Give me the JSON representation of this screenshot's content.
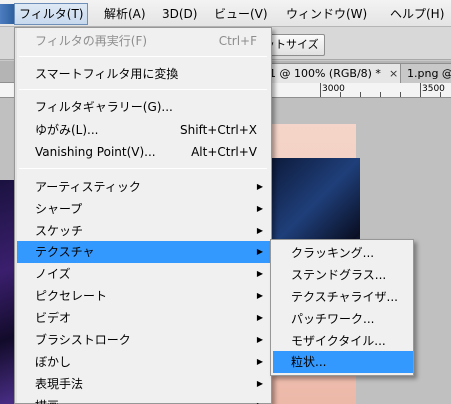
{
  "menubar": {
    "items": [
      {
        "label": "フィルタ(T)",
        "active": true
      },
      {
        "label": "解析(A)"
      },
      {
        "label": "3D(D)"
      },
      {
        "label": "ビュー(V)"
      },
      {
        "label": "ウィンドウ(W)"
      },
      {
        "label": "ヘルプ(H)"
      }
    ]
  },
  "options": {
    "fit_button_label": "ットサイズ"
  },
  "tabs": [
    {
      "label": "1 @ 100% (RGB/8) *",
      "close": "×"
    },
    {
      "label": "1.png @",
      "close": ""
    }
  ],
  "ruler": {
    "labels": [
      "3000",
      "3500"
    ]
  },
  "filter_menu": {
    "items": [
      {
        "label": "フィルタの再実行(F)",
        "shortcut": "Ctrl+F",
        "disabled": true
      },
      {
        "label": "スマートフィルタ用に変換"
      },
      {
        "label": "フィルタギャラリー(G)..."
      },
      {
        "label": "ゆがみ(L)...",
        "shortcut": "Shift+Ctrl+X"
      },
      {
        "label": "Vanishing Point(V)...",
        "shortcut": "Alt+Ctrl+V"
      },
      {
        "label": "アーティスティック",
        "submenu": true
      },
      {
        "label": "シャープ",
        "submenu": true
      },
      {
        "label": "スケッチ",
        "submenu": true
      },
      {
        "label": "テクスチャ",
        "submenu": true,
        "highlighted": true
      },
      {
        "label": "ノイズ",
        "submenu": true
      },
      {
        "label": "ピクセレート",
        "submenu": true
      },
      {
        "label": "ビデオ",
        "submenu": true
      },
      {
        "label": "ブラシストローク",
        "submenu": true
      },
      {
        "label": "ぼかし",
        "submenu": true
      },
      {
        "label": "表現手法",
        "submenu": true
      },
      {
        "label": "描画",
        "submenu": true
      }
    ],
    "arrow_glyph": "▶"
  },
  "texture_submenu": {
    "items": [
      {
        "label": "クラッキング..."
      },
      {
        "label": "ステンドグラス..."
      },
      {
        "label": "テクスチャライザ..."
      },
      {
        "label": "パッチワーク..."
      },
      {
        "label": "モザイクタイル..."
      },
      {
        "label": "粒状...",
        "highlighted": true
      }
    ]
  },
  "colors": {
    "highlight": "#3399ff",
    "menu_bg": "#f0f0f0",
    "disabled_text": "#8d8d8d"
  }
}
